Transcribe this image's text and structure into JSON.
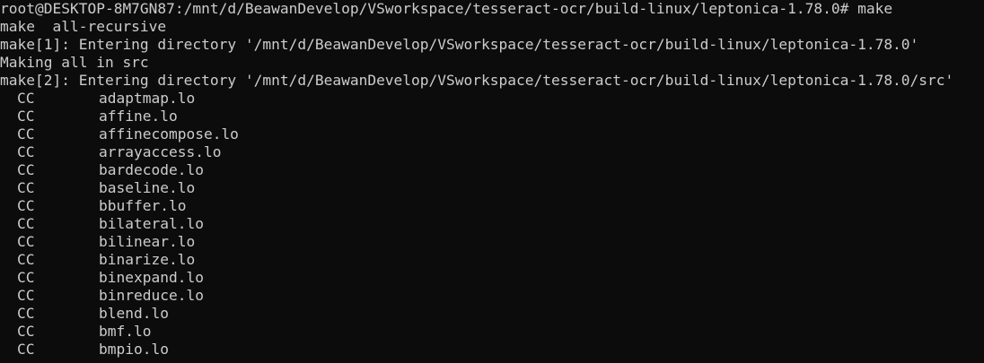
{
  "terminal": {
    "background": "#0c0c0c",
    "foreground": "#cccccc",
    "lines": [
      "root@DESKTOP-8M7GN87:/mnt/d/BeawanDevelop/VSworkspace/tesseract-ocr/build-linux/leptonica-1.78.0# make",
      "make  all-recursive",
      "make[1]: Entering directory '/mnt/d/BeawanDevelop/VSworkspace/tesseract-ocr/build-linux/leptonica-1.78.0'",
      "Making all in src",
      "make[2]: Entering directory '/mnt/d/BeawanDevelop/VSworkspace/tesseract-ocr/build-linux/leptonica-1.78.0/src'"
    ],
    "compile_tag": "CC",
    "compiled_files": [
      "adaptmap.lo",
      "affine.lo",
      "affinecompose.lo",
      "arrayaccess.lo",
      "bardecode.lo",
      "baseline.lo",
      "bbuffer.lo",
      "bilateral.lo",
      "bilinear.lo",
      "binarize.lo",
      "binexpand.lo",
      "binreduce.lo",
      "blend.lo",
      "bmf.lo",
      "bmpio.lo"
    ]
  }
}
